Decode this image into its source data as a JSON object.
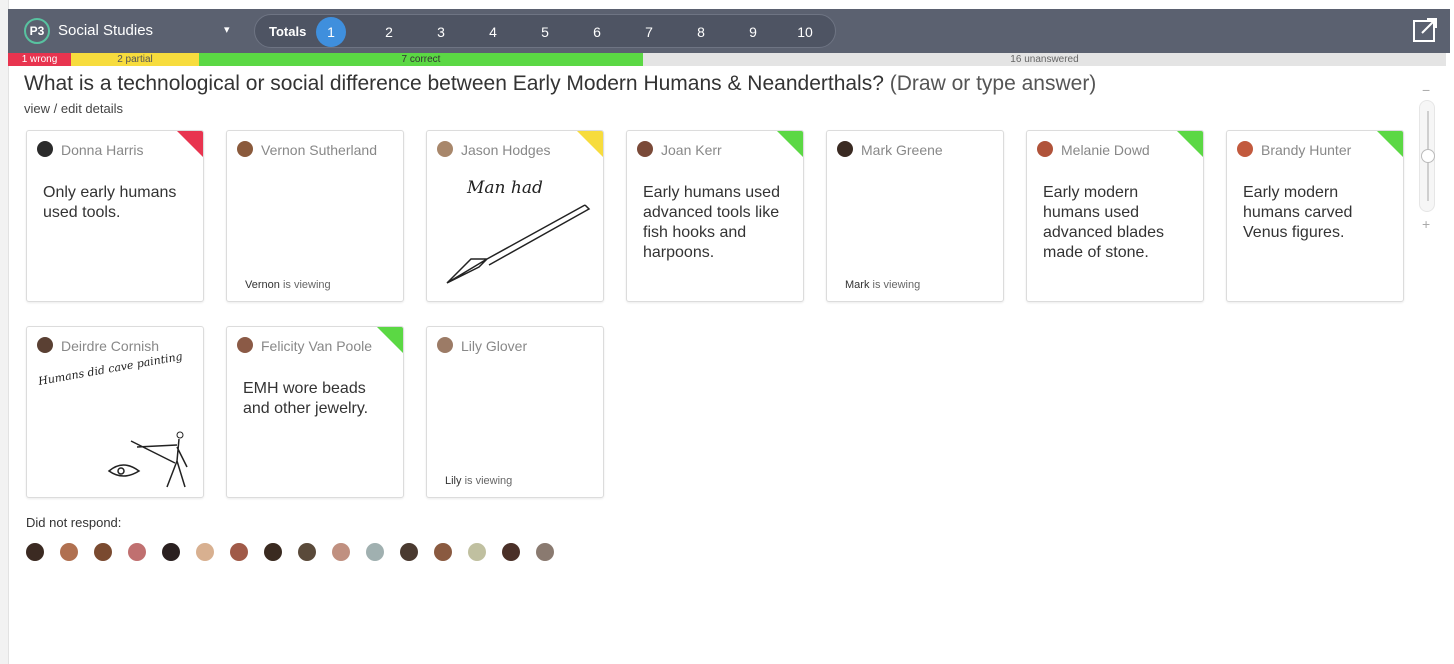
{
  "header": {
    "class_badge": "P3",
    "class_name": "Social Studies",
    "caret": "▾",
    "totals_label": "Totals",
    "questions": [
      "1",
      "2",
      "3",
      "4",
      "5",
      "6",
      "7",
      "8",
      "9",
      "10"
    ],
    "active_question": "1"
  },
  "status": {
    "wrong": "1 wrong",
    "partial": "2 partial",
    "correct": "7 correct",
    "unanswered": "16 unanswered"
  },
  "question": {
    "text": "What is a technological or social difference between Early Modern Humans & Neanderthals?",
    "hint": "(Draw or type answer)",
    "details_link": "view / edit details"
  },
  "colors": {
    "wrong": "#e8344f",
    "partial": "#f7dc3d",
    "correct": "#5bd844",
    "active": "#3f8fdd"
  },
  "cards": [
    {
      "name": "Donna Harris",
      "answer": "Only early humans used tools.",
      "flag": "red",
      "avatar": "#2b2b2b"
    },
    {
      "name": "Vernon Sutherland",
      "answer": "",
      "flag": "none",
      "avatar": "#8a5a3c",
      "viewing_name": "Vernon",
      "viewing_text": "is viewing"
    },
    {
      "name": "Jason Hodges",
      "answer": "",
      "flag": "yellow",
      "avatar": "#a8876b",
      "drawing_text": "Man had"
    },
    {
      "name": "Joan Kerr",
      "answer": "Early humans used advanced tools like fish hooks and harpoons.",
      "flag": "green",
      "avatar": "#7a4a38"
    },
    {
      "name": "Mark Greene",
      "answer": "",
      "flag": "none",
      "avatar": "#3a2a22",
      "viewing_name": "Mark",
      "viewing_text": "is viewing"
    },
    {
      "name": "Melanie Dowd",
      "answer": "Early modern humans used advanced blades made of stone.",
      "flag": "green",
      "avatar": "#b0533a"
    },
    {
      "name": "Brandy Hunter",
      "answer": "Early modern humans carved Venus figures.",
      "flag": "green",
      "avatar": "#c25a3e"
    },
    {
      "name": "Deirdre Cornish",
      "answer": "",
      "flag": "none",
      "avatar": "#5a4033",
      "drawing_text": "Humans did cave painting"
    },
    {
      "name": "Felicity Van Poole",
      "answer": "EMH wore beads and other jewelry.",
      "flag": "green",
      "avatar": "#8b5a46"
    },
    {
      "name": "Lily Glover",
      "answer": "",
      "flag": "none",
      "avatar": "#9c7b66",
      "viewing_name": "Lily",
      "viewing_text": "is viewing"
    }
  ],
  "zoom": {
    "minus": "−",
    "plus": "+"
  },
  "did_not_respond": {
    "label": "Did not respond:",
    "avatars": [
      "#3b2a22",
      "#b07050",
      "#7a4a30",
      "#c07070",
      "#2a2020",
      "#d8b090",
      "#a05a48",
      "#3a2a20",
      "#5a4a3a",
      "#c09080",
      "#a0b0b0",
      "#4a3a30",
      "#8a5a40",
      "#c0c0a0",
      "#4a3028",
      "#8a7a70"
    ]
  }
}
